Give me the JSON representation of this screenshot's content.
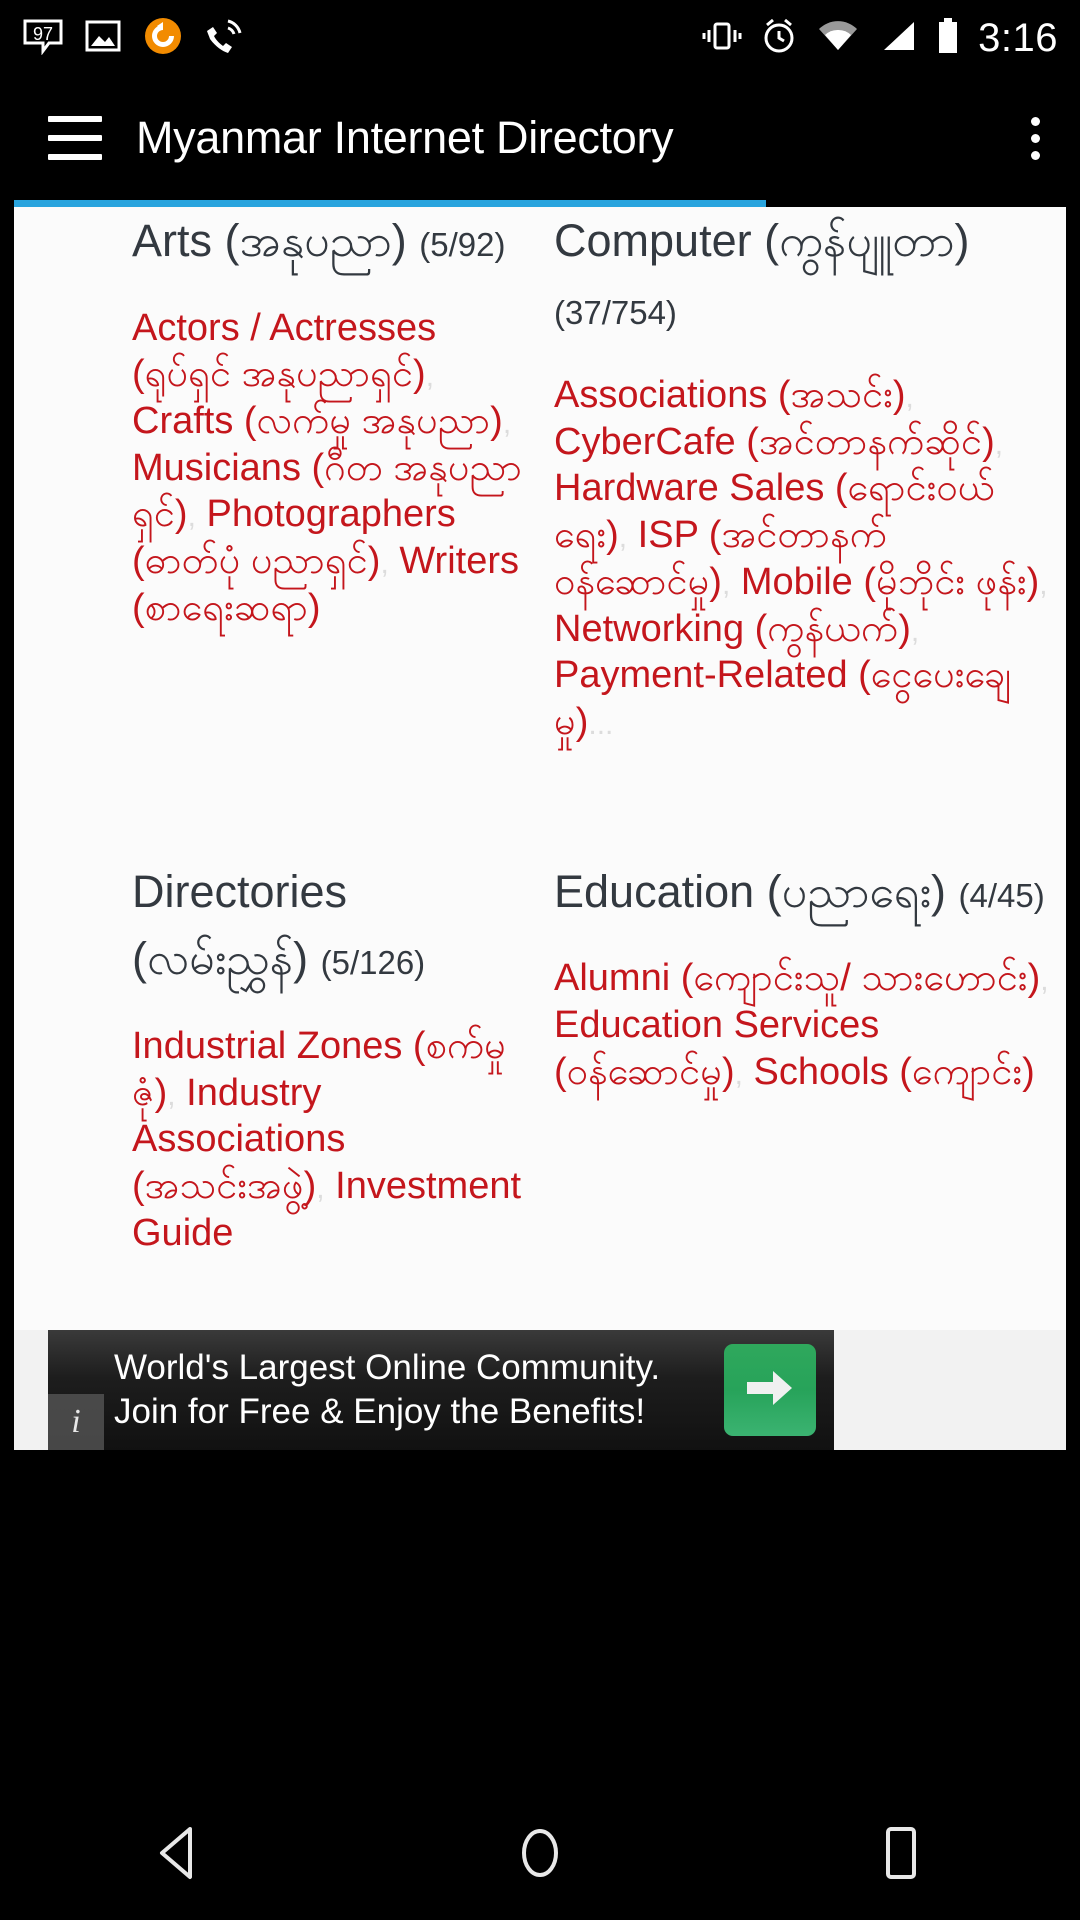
{
  "status_bar": {
    "time": "3:16",
    "left_icons": [
      "sms-97-icon",
      "gallery-image-icon",
      "sync-circle-icon",
      "phone-call-icon"
    ],
    "right_icons": [
      "vibrate-icon",
      "alarm-clock-icon",
      "wifi-icon",
      "signal-icon",
      "battery-icon"
    ],
    "sms_badge": "97"
  },
  "app_bar": {
    "menu_icon": "hamburger-menu-icon",
    "title": "Myanmar Internet Directory",
    "overflow_icon": "more-vertical-icon",
    "accent_color": "#29a4de"
  },
  "categories": [
    {
      "name_en": "Arts",
      "name_my": "(အနုပညာ)",
      "count": "(5/92)",
      "links": [
        "Actors / Actresses (ရုပ်ရှင် အနုပညာရှင်)",
        "Crafts (လက်မှု အနုပညာ)",
        "Musicians (ဂီတ အနုပညာရှင်)",
        "Photographers (ဓာတ်ပုံ ပညာရှင်)",
        "Writers (စာရေးဆရာ)"
      ],
      "more": ""
    },
    {
      "name_en": "Computer",
      "name_my": "(ကွန်ပျူတာ)",
      "count": "(37/754)",
      "links": [
        "Associations (အသင်း)",
        "CyberCafe (အင်တာနက်ဆိုင်)",
        "Hardware Sales (ရောင်းဝယ်ရေး)",
        "ISP (အင်တာနက် ဝန်ဆောင်မှု)",
        "Mobile (မိုဘိုင်း ဖုန်း)",
        "Networking (ကွန်ယက်)",
        "Payment-Related (ငွေပေးချေမှု)"
      ],
      "more": "..."
    },
    {
      "name_en": "Directories",
      "name_my": "(လမ်းညွှန်)",
      "count": "(5/126)",
      "links": [
        "Industrial Zones (စက်မှုဇုံ)",
        "Industry Associations (အသင်းအဖွဲ့)",
        "Investment Guide"
      ],
      "more": ""
    },
    {
      "name_en": "Education",
      "name_my": "(ပညာရေး)",
      "count": "(4/45)",
      "links": [
        "Alumni (ကျောင်းသူ/ သားဟောင်း)",
        "Education Services (ဝန်ဆောင်မှု)",
        "Schools (ကျောင်း)"
      ],
      "more": ""
    }
  ],
  "link_separator": ",",
  "ad": {
    "line1": "World's Largest Online Community.",
    "line2": "Join for Free & Enjoy the Benefits!",
    "cta_icon": "arrow-right-icon",
    "info_label": "i",
    "cta_color": "#2fa85c"
  },
  "nav_bar": {
    "back": "back-triangle-icon",
    "home": "home-circle-icon",
    "recents": "recents-square-icon"
  },
  "colors": {
    "link": "#c4161c",
    "heading": "#333940",
    "accent": "#29a4de"
  }
}
